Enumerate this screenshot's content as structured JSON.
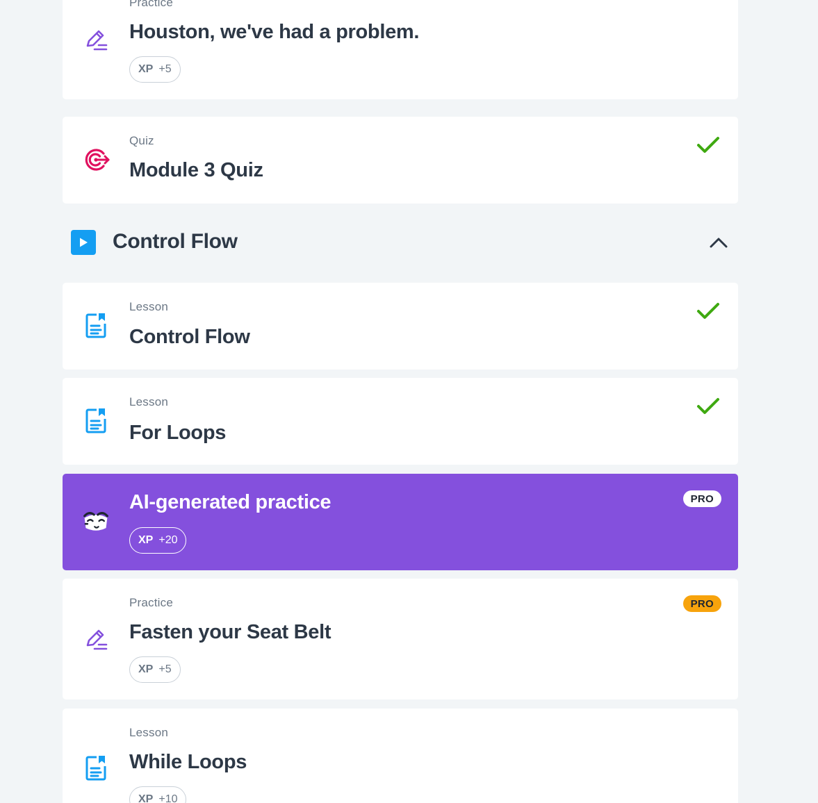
{
  "cards": [
    {
      "kind": "Practice",
      "title": "Houston, we've had a problem.",
      "xp_label": "XP",
      "xp_value": "+5",
      "icon": "pencil-icon",
      "completed": false
    },
    {
      "kind": "Quiz",
      "title": "Module 3 Quiz",
      "icon": "target-icon",
      "completed": true
    },
    {
      "kind": "Lesson",
      "title": "Control Flow",
      "icon": "lesson-doc-icon",
      "completed": true
    },
    {
      "kind": "Lesson",
      "title": "For Loops",
      "icon": "lesson-doc-icon",
      "completed": true
    },
    {
      "title": "AI-generated practice",
      "xp_label": "XP",
      "xp_value": "+20",
      "badge": "PRO",
      "icon": "ai-mascot-icon",
      "completed": false
    },
    {
      "kind": "Practice",
      "title": "Fasten your Seat Belt",
      "xp_label": "XP",
      "xp_value": "+5",
      "badge": "PRO",
      "icon": "pencil-icon",
      "completed": false
    },
    {
      "kind": "Lesson",
      "title": "While Loops",
      "xp_label": "XP",
      "xp_value": "+10",
      "icon": "lesson-doc-icon",
      "completed": false
    }
  ],
  "section": {
    "title": "Control Flow",
    "expanded": true,
    "icon": "play-icon"
  },
  "colors": {
    "background": "#f2f5f7",
    "accent_purple": "#8450dd",
    "check_green": "#3fa911",
    "lesson_blue": "#149ef2",
    "quiz_pink": "#e0115f",
    "pro_orange": "#f7a30c"
  }
}
